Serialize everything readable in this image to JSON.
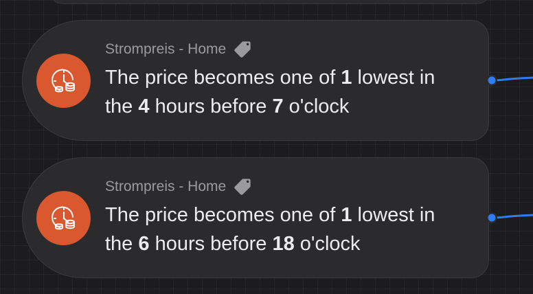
{
  "cards": [
    {
      "subtitle": "Strompreis - Home",
      "text": {
        "p1": "The price becomes one of ",
        "count": "1",
        "p2": " lowest in",
        "p3": "the ",
        "hours": "4",
        "p4": " hours before ",
        "clock": "7",
        "p5": " o'clock"
      },
      "icon": "clock-coins-icon",
      "tag_icon": "tag-icon"
    },
    {
      "subtitle": "Strompreis - Home",
      "text": {
        "p1": "The price becomes one of ",
        "count": "1",
        "p2": " lowest in",
        "p3": "the ",
        "hours": "6",
        "p4": " hours before ",
        "clock": "18",
        "p5": " o'clock"
      },
      "icon": "clock-coins-icon",
      "tag_icon": "tag-icon"
    }
  ],
  "colors": {
    "canvas_bg": "#1c1c1e",
    "card_bg": "#2b2b2e",
    "icon_bg": "#d9582f",
    "connector": "#2f7bf5",
    "text": "#ececef",
    "subtitle": "#9a9a9f"
  }
}
